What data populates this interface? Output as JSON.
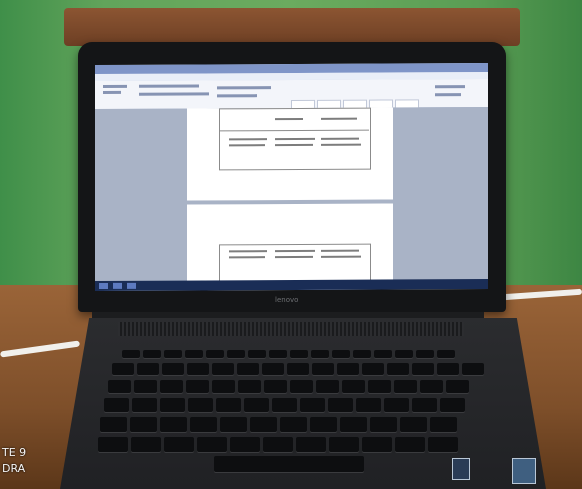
{
  "scene": {
    "subject": "laptop-on-wooden-table",
    "colors": {
      "wall": "#62a45b",
      "table": "#8a5a34",
      "laptop": "#141517",
      "screen": "#c8d2e6"
    }
  },
  "laptop": {
    "brand": "lenovo"
  },
  "photo_overlay": {
    "line1": "TE 9",
    "line2": "DRA"
  }
}
